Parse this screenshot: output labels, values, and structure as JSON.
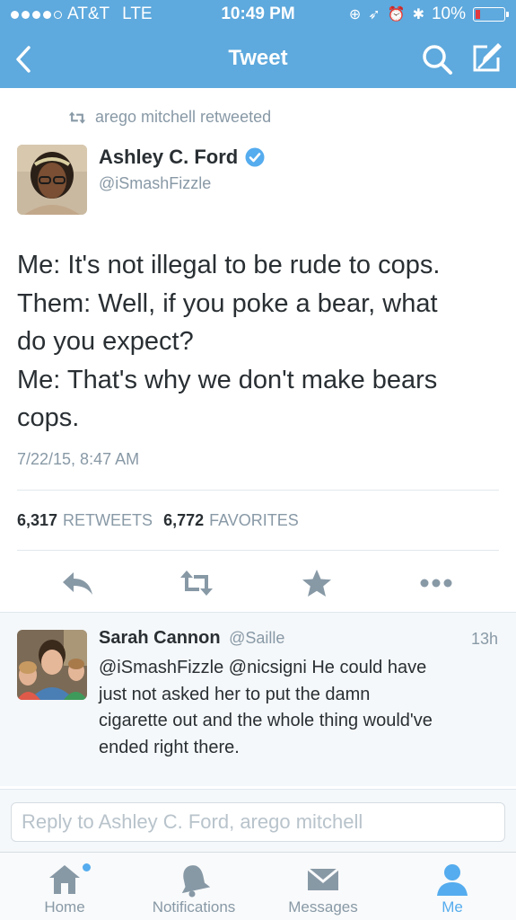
{
  "status_bar": {
    "signal": "●●●●○",
    "carrier": "AT&T",
    "network": "LTE",
    "time": "10:49 PM",
    "battery": "10%"
  },
  "nav": {
    "title": "Tweet"
  },
  "retweet_line": {
    "text": "arego mitchell retweeted",
    "icon": "retweet-icon"
  },
  "tweet": {
    "author_name": "Ashley C. Ford",
    "verified": true,
    "author_handle": "@iSmashFizzle",
    "text_lines": [
      "Me: It's not illegal to be rude to cops.",
      "Them: Well, if you poke a bear, what",
      "do you expect?",
      "Me: That's why we don't make bears",
      "cops."
    ],
    "timestamp": "7/22/15, 8:47 AM",
    "retweets_count": "6,317",
    "retweets_label": "RETWEETS",
    "favorites_count": "6,772",
    "favorites_label": "FAVORITES"
  },
  "actions": [
    "reply-icon",
    "retweet-icon",
    "star-icon",
    "more-icon"
  ],
  "reply": {
    "name": "Sarah Cannon",
    "handle": "@Saille",
    "time": "13h",
    "text_lines": [
      "@iSmashFizzle @nicsigni He could have",
      "just not asked her to put the damn",
      "cigarette out and the whole thing would've",
      "ended right there."
    ]
  },
  "reply_box": {
    "placeholder": "Reply to Ashley C. Ford, arego mitchell"
  },
  "tabs": [
    {
      "label": "Home",
      "icon": "home-icon",
      "active": false,
      "badge": true
    },
    {
      "label": "Notifications",
      "icon": "bell-icon",
      "active": false
    },
    {
      "label": "Messages",
      "icon": "envelope-icon",
      "active": false
    },
    {
      "label": "Me",
      "icon": "person-icon",
      "active": true
    }
  ],
  "colors": {
    "brand": "#5ea9dd",
    "accent": "#55acee",
    "text": "#292f33",
    "muted": "#8899a6",
    "battery_low": "#e0393e"
  }
}
